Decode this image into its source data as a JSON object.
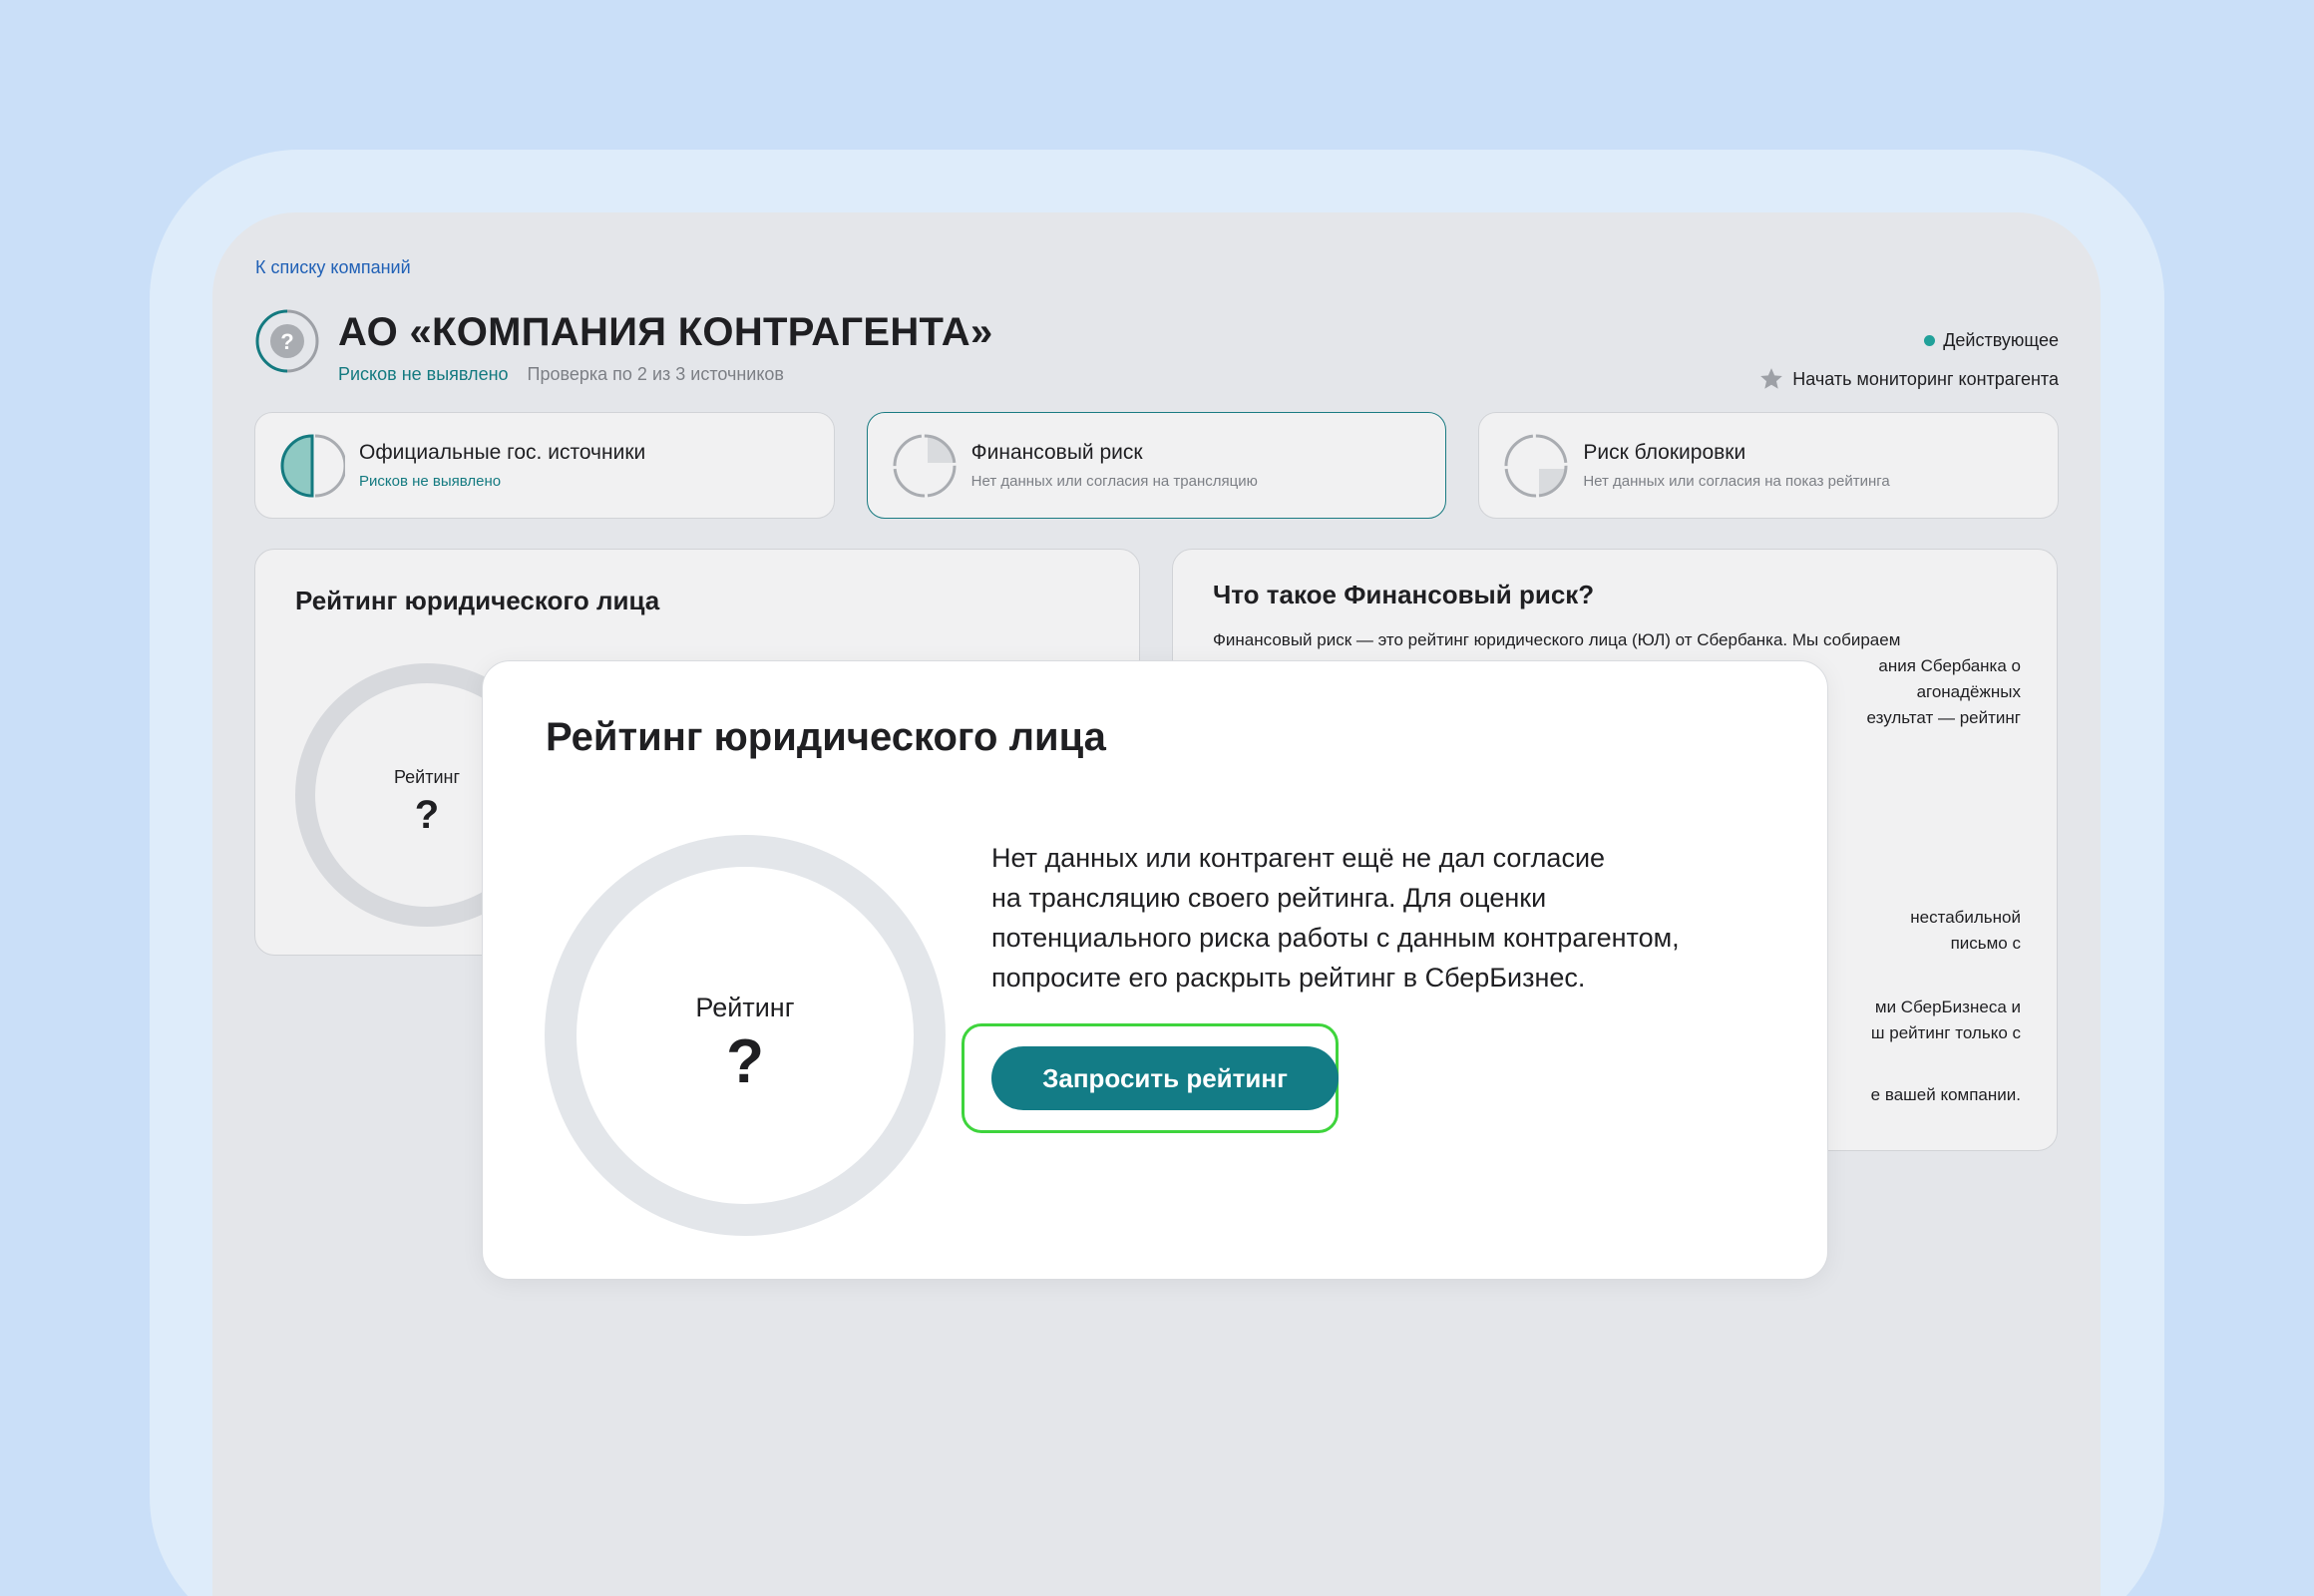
{
  "nav": {
    "back_label": "К списку компаний"
  },
  "company": {
    "name": "АО «КОМПАНИЯ КОНТРАГЕНТА»",
    "risk_status": "Рисков не выявлено",
    "check_status": "Проверка по 2 из 3 источников",
    "status": "Действующее",
    "monitor_label": "Начать мониторинг контрагента",
    "logo_icon": "question-mark-icon"
  },
  "risk_cards": [
    {
      "title": "Официальные гос. источники",
      "subtitle": "Рисков не выявлено"
    },
    {
      "title": "Финансовый риск",
      "subtitle": "Нет данных или согласия на трансляцию"
    },
    {
      "title": "Риск блокировки",
      "subtitle": "Нет данных или согласия на показ рейтинга"
    }
  ],
  "rating_panel": {
    "title": "Рейтинг юридического лица",
    "ring_label": "Рейтинг",
    "ring_value": "?"
  },
  "info_panel": {
    "title": "Что такое Финансовый риск?",
    "lines": [
      "Финансовый риск — это рейтинг юридического лица (ЮЛ) от Сбербанка. Мы собираем",
      "ания Сбербанка о",
      "агонадёжных",
      "езультат — рейтинг",
      "нестабильной",
      "письмо с",
      "ми СберБизнеса и",
      "ш рейтинг только с",
      "е вашей компании."
    ]
  },
  "modal": {
    "title": "Рейтинг юридического лица",
    "ring_label": "Рейтинг",
    "ring_value": "?",
    "text_lines": [
      "Нет данных или контрагент ещё не дал согласие",
      "на трансляцию своего рейтинга. Для оценки",
      "потенциального риска работы с данным контрагентом,",
      "попросите его раскрыть рейтинг в СберБизнес."
    ],
    "button_label": "Запросить рейтинг"
  },
  "colors": {
    "accent": "#137c86",
    "highlight": "#3ed43c",
    "status_dot": "#21a19a",
    "link": "#2161b6"
  }
}
